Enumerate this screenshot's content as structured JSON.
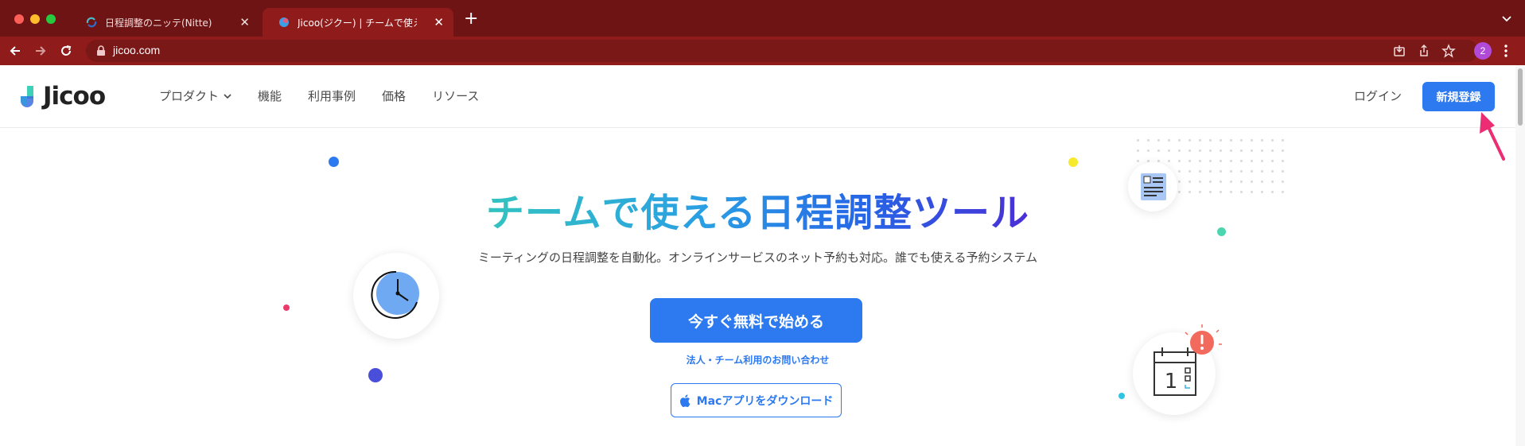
{
  "browser": {
    "tabs": [
      {
        "title": "日程調整のニッテ(Nitte)",
        "active": false
      },
      {
        "title": "Jicoo(ジクー) | チームで使える日程調整ツール",
        "active": true
      }
    ],
    "url": "jicoo.com",
    "profile_initial": "2",
    "colors": {
      "chrome": "#8f1b1b",
      "tabbar": "#6e1414"
    }
  },
  "site": {
    "logo_text": "Jicoo",
    "nav": [
      {
        "label": "プロダクト",
        "has_dropdown": true
      },
      {
        "label": "機能"
      },
      {
        "label": "利用事例"
      },
      {
        "label": "価格"
      },
      {
        "label": "リソース"
      }
    ],
    "login_label": "ログイン",
    "signup_label": "新規登録",
    "accent": "#2c79f0"
  },
  "hero": {
    "title": "チームで使える日程調整ツール",
    "subtitle": "ミーティングの日程調整を自動化。オンラインサービスのネット予約も対応。誰でも使える予約システム",
    "cta_label": "今すぐ無料で始める",
    "contact_link": "法人・チーム利用のお問い合わせ",
    "mac_button_label": "Macアプリをダウンロード",
    "calendar_day": "1"
  }
}
